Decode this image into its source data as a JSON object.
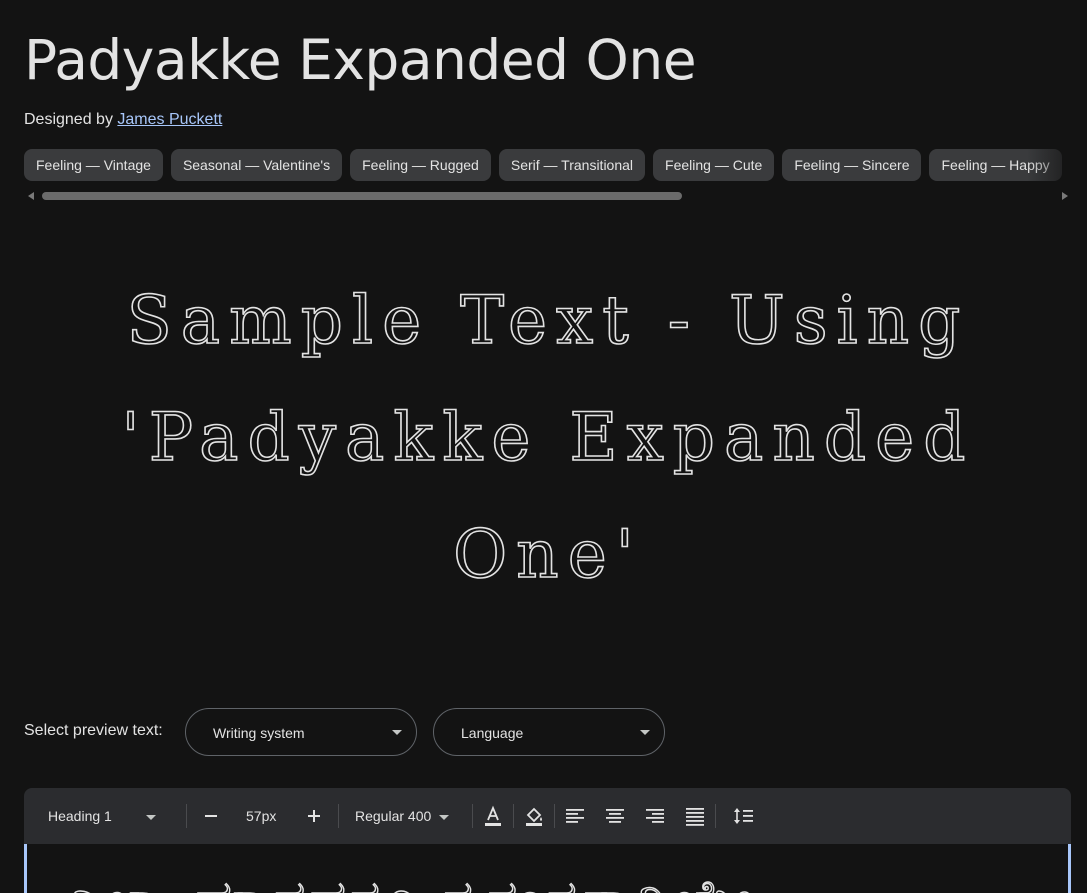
{
  "font": {
    "name": "Padyakke Expanded One",
    "designed_by_label": "Designed by",
    "designer": "James Puckett"
  },
  "tags": [
    "Feeling — Vintage",
    "Seasonal — Valentine's",
    "Feeling — Rugged",
    "Serif — Transitional",
    "Feeling — Cute",
    "Feeling — Sincere",
    "Feeling — Happy"
  ],
  "sample_text": "Sample Text - Using 'Padyakke Expanded One'",
  "preview": {
    "label": "Select preview text:",
    "writing_system": "Writing system",
    "language": "Language"
  },
  "toolbar": {
    "style": "Heading 1",
    "size": "57px",
    "weight": "Regular 400"
  },
  "editor_text": "ಎಲ್ಲಾ ಮಾನವರೂ ಸ್ವತಂತ್ರರಾಗಿಯೇ"
}
